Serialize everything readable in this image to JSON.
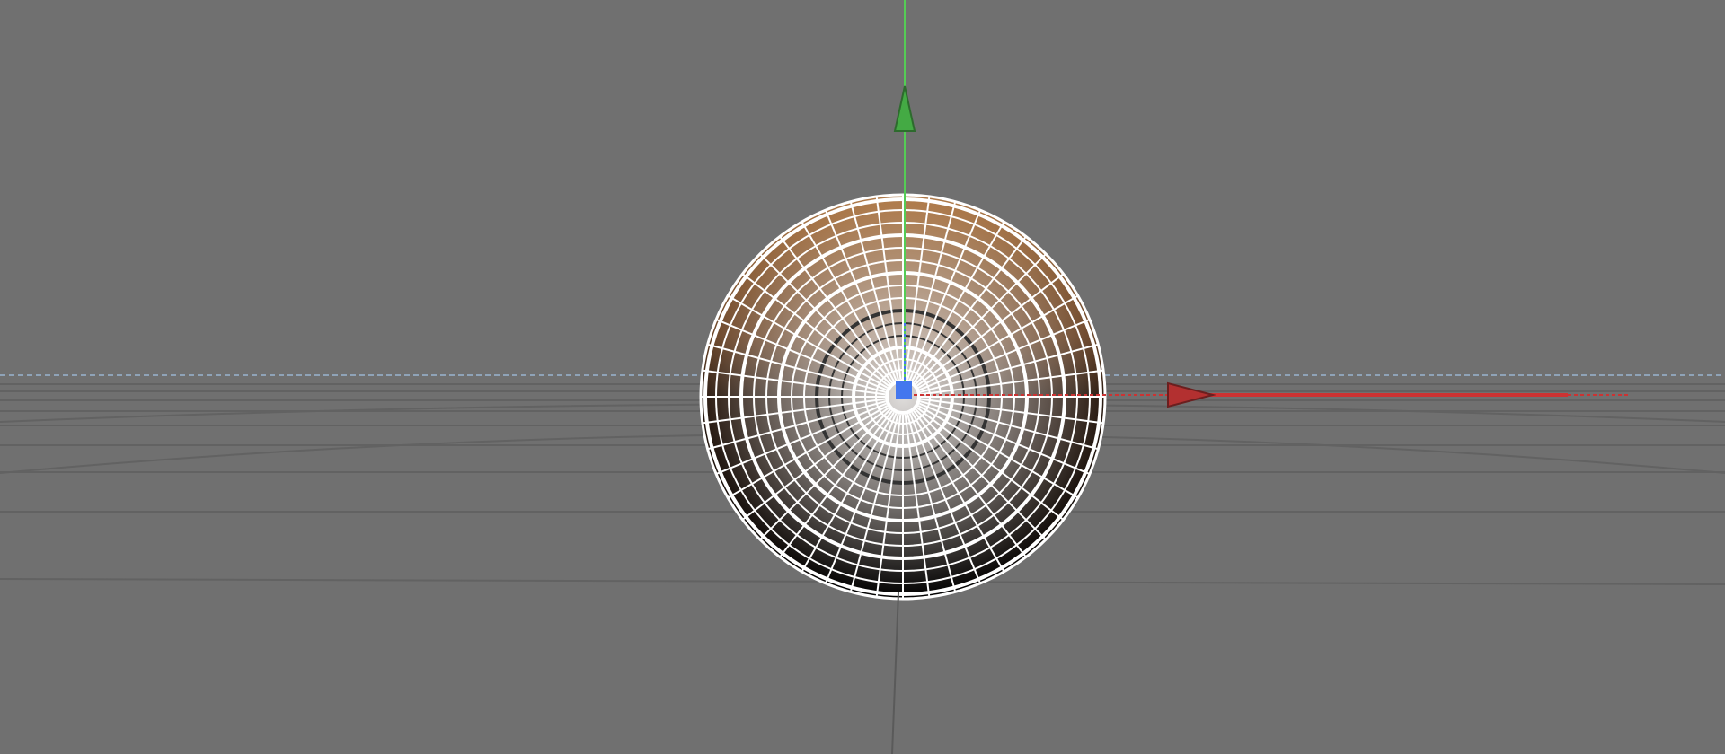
{
  "viewport": {
    "view": "perspective-3d",
    "background_color": "#707070",
    "grid": {
      "visible": true,
      "line_color": "#626262",
      "horizon_color": "#8fa3b8"
    },
    "selected_object": {
      "type": "sphere",
      "display_mode": "wireframe-shaded",
      "shading_colors": [
        "#b07a48",
        "#5a3a22",
        "#000000"
      ],
      "wire_color": "#ffffff"
    },
    "gizmo": {
      "mode": "move",
      "axes": [
        {
          "name": "x",
          "color": "#cc3333",
          "icon": "x-axis-arrow-icon"
        },
        {
          "name": "y",
          "color": "#44bb44",
          "icon": "y-axis-arrow-icon"
        },
        {
          "name": "z",
          "color": "#4477ee",
          "icon": "z-axis-origin-icon"
        }
      ]
    }
  }
}
